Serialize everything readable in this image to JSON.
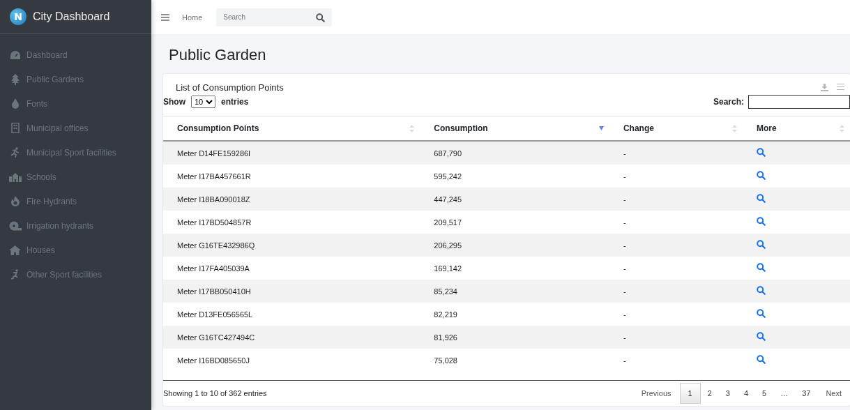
{
  "brand": {
    "name": "City Dashboard",
    "logo_letter": "N"
  },
  "topbar": {
    "home": "Home",
    "search_placeholder": "Search"
  },
  "sidebar": {
    "items": [
      {
        "label": "Dashboard"
      },
      {
        "label": "Public Gardens"
      },
      {
        "label": "Fonts"
      },
      {
        "label": "Municipal offices"
      },
      {
        "label": "Municipal Sport facilities"
      },
      {
        "label": "Schools"
      },
      {
        "label": "Fire Hydrants"
      },
      {
        "label": "Irrigation hydrants"
      },
      {
        "label": "Houses"
      },
      {
        "label": "Other Sport facilities"
      }
    ]
  },
  "page_title": "Public Garden",
  "card": {
    "title": "List of Consumption Points",
    "show_label": "Show",
    "page_size": "10",
    "entries_label": "entries",
    "search_label": "Search:",
    "table": {
      "columns": [
        {
          "label": "Consumption Points",
          "sorted": false
        },
        {
          "label": "Consumption",
          "sorted": true
        },
        {
          "label": "Change",
          "sorted": false
        },
        {
          "label": "More",
          "sorted": false
        }
      ],
      "rows": [
        {
          "point": "Meter D14FE159286I",
          "consumption": "687,790",
          "change": "-"
        },
        {
          "point": "Meter I17BA457661R",
          "consumption": "595,242",
          "change": "-"
        },
        {
          "point": "Meter I18BA090018Z",
          "consumption": "447,245",
          "change": "-"
        },
        {
          "point": "Meter I17BD504857R",
          "consumption": "209,517",
          "change": "-"
        },
        {
          "point": "Meter G16TE432986Q",
          "consumption": "206,295",
          "change": "-"
        },
        {
          "point": "Meter I17FA405039A",
          "consumption": "169,142",
          "change": "-"
        },
        {
          "point": "Meter I17BB050410H",
          "consumption": "85,234",
          "change": "-"
        },
        {
          "point": "Meter D13FE056565L",
          "consumption": "82,219",
          "change": "-"
        },
        {
          "point": "Meter G16TC427494C",
          "consumption": "81,926",
          "change": "-"
        },
        {
          "point": "Meter I16BD085650J",
          "consumption": "75,028",
          "change": "-"
        }
      ]
    },
    "info": "Showing 1 to 10 of 362 entries",
    "pagination": {
      "previous": "Previous",
      "next": "Next",
      "pages": [
        {
          "label": "1",
          "selected": true
        },
        {
          "label": "2",
          "selected": false
        },
        {
          "label": "3",
          "selected": false
        },
        {
          "label": "4",
          "selected": false
        },
        {
          "label": "5",
          "selected": false
        },
        {
          "label": "…",
          "selected": false
        },
        {
          "label": "37",
          "selected": false
        }
      ]
    }
  }
}
